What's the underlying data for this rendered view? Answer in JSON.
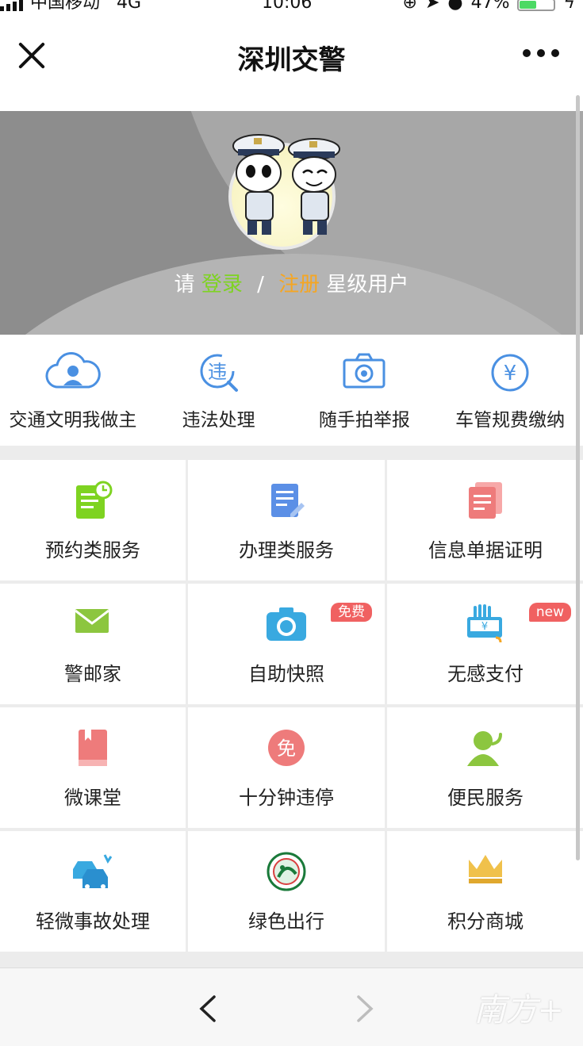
{
  "status_bar": {
    "carrier": "中国移动",
    "network": "4G",
    "time": "10:06",
    "battery": "47%"
  },
  "header": {
    "title": "深圳交警"
  },
  "hero": {
    "login_prefix": "请",
    "login": "登录",
    "separator": "/",
    "register": "注册",
    "suffix": "星级用户"
  },
  "quick_actions": [
    {
      "label": "交通文明我做主",
      "icon": "cloud-user-icon"
    },
    {
      "label": "违法处理",
      "icon": "violation-search-icon"
    },
    {
      "label": "随手拍举报",
      "icon": "camera-outline-icon"
    },
    {
      "label": "车管规费缴纳",
      "icon": "yuan-coin-icon"
    }
  ],
  "services": [
    {
      "label": "预约类服务",
      "icon": "appointment-clock-icon"
    },
    {
      "label": "办理类服务",
      "icon": "document-edit-icon"
    },
    {
      "label": "信息单据证明",
      "icon": "receipt-icon"
    },
    {
      "label": "警邮家",
      "icon": "envelope-icon"
    },
    {
      "label": "自助快照",
      "icon": "camera-icon",
      "badge": "免费"
    },
    {
      "label": "无感支付",
      "icon": "contactless-pay-icon",
      "badge": "new"
    },
    {
      "label": "微课堂",
      "icon": "book-icon"
    },
    {
      "label": "十分钟违停",
      "icon": "free-parking-icon",
      "icon_text": "免"
    },
    {
      "label": "便民服务",
      "icon": "phone-agent-icon"
    },
    {
      "label": "轻微事故处理",
      "icon": "car-accident-icon"
    },
    {
      "label": "绿色出行",
      "icon": "green-travel-icon"
    },
    {
      "label": "积分商城",
      "icon": "crown-icon"
    }
  ],
  "watermark": "南方+",
  "colors": {
    "green": "#7ed321",
    "orange": "#f5a623",
    "blue_icon": "#4a90e2",
    "badge_red": "#f06161",
    "hero_gray": "#8d8d8d"
  }
}
